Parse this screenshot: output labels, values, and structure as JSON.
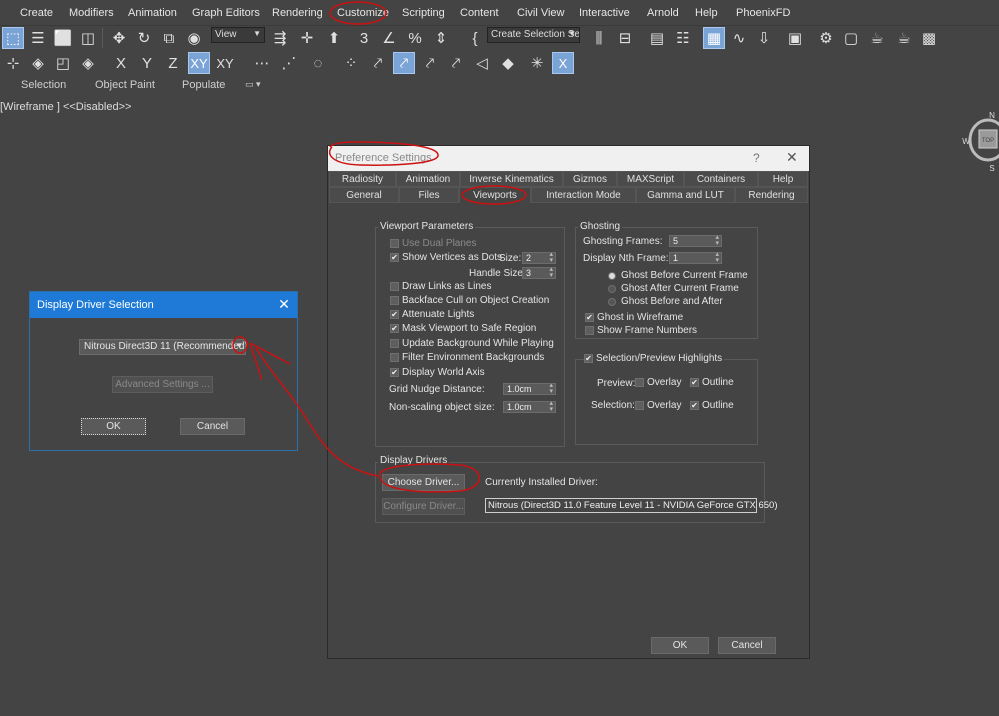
{
  "menubar": {
    "items": [
      "Create",
      "Modifiers",
      "Animation",
      "Graph Editors",
      "Rendering",
      "Customize",
      "Scripting",
      "Content",
      "Civil View",
      "Interactive",
      "Arnold",
      "Help",
      "PhoenixFD"
    ]
  },
  "toolbar1": {
    "view_dropdown": "View",
    "selection_set_dropdown": "Create Selection Se"
  },
  "toolbar2": {
    "axis_x": "X",
    "axis_y": "Y",
    "axis_z": "Z",
    "axis_xy": "XY",
    "axis_xy2": "XY"
  },
  "ribbon_tabs": [
    "Selection",
    "Object Paint",
    "Populate"
  ],
  "viewport": {
    "label": "[Wireframe ] <<Disabled>>",
    "cube": {
      "top": "TOP",
      "n": "N",
      "w": "W",
      "s": "S"
    }
  },
  "display_driver_dialog": {
    "title": "Display Driver Selection",
    "close": "✕",
    "driver_select": "Nitrous Direct3D 11 (Recommended)",
    "advanced_button": "Advanced Settings ...",
    "ok_button": "OK",
    "cancel_button": "Cancel"
  },
  "preference_dialog": {
    "title": "Preference Settings",
    "help": "?",
    "close": "✕",
    "tabs_row1": [
      "Radiosity",
      "Animation",
      "Inverse Kinematics",
      "Gizmos",
      "MAXScript",
      "Containers",
      "Help"
    ],
    "tabs_row2": [
      "General",
      "Files",
      "Viewports",
      "Interaction Mode",
      "Gamma and LUT",
      "Rendering"
    ],
    "viewport_params": {
      "title": "Viewport Parameters",
      "use_dual_planes": "Use Dual Planes",
      "show_vertices": "Show Vertices as Dots",
      "size_label": "Size:",
      "size_value": "2",
      "handle_size_label": "Handle Size:",
      "handle_size_value": "3",
      "draw_links": "Draw Links as Lines",
      "backface_cull": "Backface Cull on Object Creation",
      "attenuate_lights": "Attenuate Lights",
      "mask_viewport": "Mask Viewport to Safe Region",
      "update_background": "Update Background While Playing",
      "filter_env": "Filter Environment Backgrounds",
      "display_world_axis": "Display World Axis",
      "grid_nudge_label": "Grid Nudge Distance:",
      "grid_nudge_value": "1.0cm",
      "nonscaling_label": "Non-scaling object size:",
      "nonscaling_value": "1.0cm"
    },
    "ghosting": {
      "title": "Ghosting",
      "frames_label": "Ghosting Frames:",
      "frames_value": "5",
      "nth_label": "Display Nth Frame:",
      "nth_value": "1",
      "before": "Ghost Before Current Frame",
      "after": "Ghost After Current Frame",
      "before_after": "Ghost Before and After",
      "in_wireframe": "Ghost in Wireframe",
      "frame_numbers": "Show Frame Numbers"
    },
    "highlights": {
      "title": "Selection/Preview Highlights",
      "preview_label": "Preview:",
      "selection_label": "Selection:",
      "overlay": "Overlay",
      "outline": "Outline"
    },
    "display_drivers": {
      "title": "Display Drivers",
      "choose_button": "Choose Driver...",
      "installed_label": "Currently Installed Driver:",
      "configure_button": "Configure Driver...",
      "installed_value": "Nitrous (Direct3D 11.0 Feature Level 11 - NVIDIA GeForce GTX 650)"
    },
    "ok_button": "OK",
    "cancel_button": "Cancel"
  },
  "colors": {
    "background": "#444444",
    "active_tool": "#7aa3d6",
    "dialog_title_blue": "#1e7ad6",
    "annotation_red": "#cc1111"
  }
}
